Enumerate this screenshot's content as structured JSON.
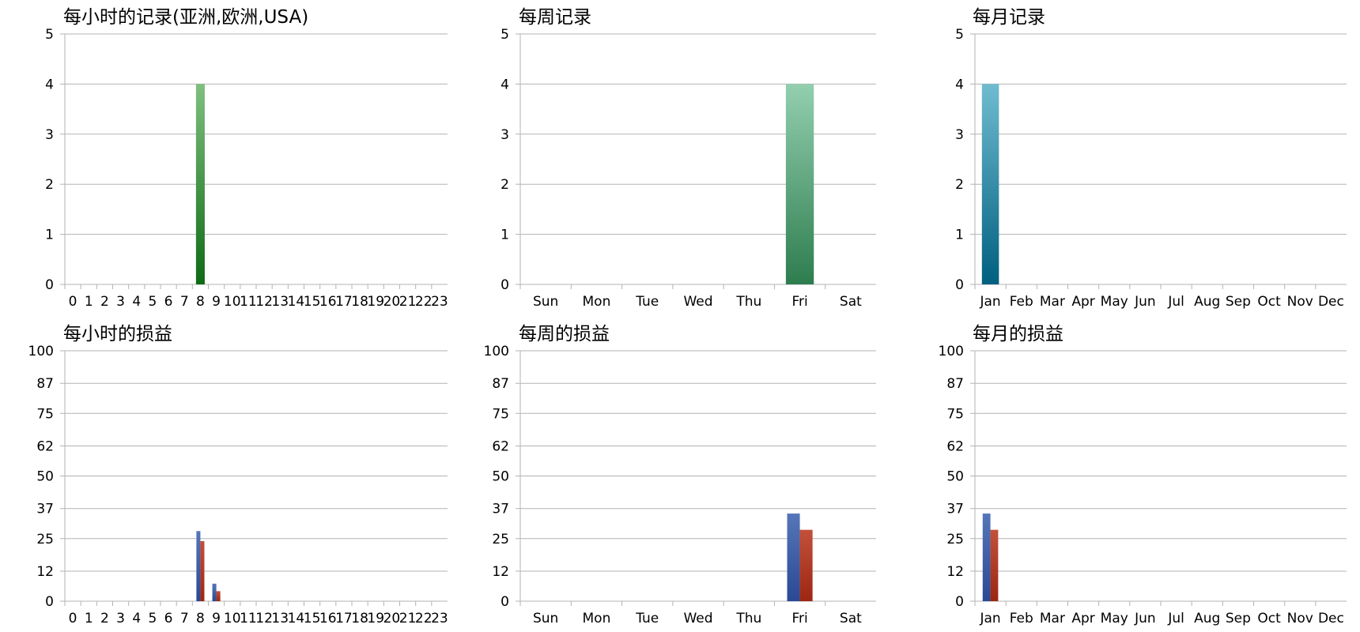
{
  "chart_data": [
    {
      "type": "bar",
      "title": "每小时的记录(亚洲,欧洲,USA)",
      "categories": [
        "0",
        "1",
        "2",
        "3",
        "4",
        "5",
        "6",
        "7",
        "8",
        "9",
        "10",
        "11",
        "12",
        "13",
        "14",
        "15",
        "16",
        "17",
        "18",
        "19",
        "20",
        "21",
        "22",
        "23"
      ],
      "ylim": [
        0,
        5
      ],
      "yticks": [
        "0",
        "1",
        "2",
        "3",
        "4",
        "5"
      ],
      "grid": true,
      "series": [
        {
          "values": [
            0,
            0,
            0,
            0,
            0,
            0,
            0,
            0,
            4,
            0,
            0,
            0,
            0,
            0,
            0,
            0,
            0,
            0,
            0,
            0,
            0,
            0,
            0,
            0
          ],
          "color_top": "#7fbf7f",
          "color_bottom": "#0e6b14"
        }
      ]
    },
    {
      "type": "bar",
      "title": "每周记录",
      "categories": [
        "Sun",
        "Mon",
        "Tue",
        "Wed",
        "Thu",
        "Fri",
        "Sat"
      ],
      "ylim": [
        0,
        5
      ],
      "yticks": [
        "0",
        "1",
        "2",
        "3",
        "4",
        "5"
      ],
      "grid": true,
      "series": [
        {
          "values": [
            0,
            0,
            0,
            0,
            0,
            4,
            0
          ],
          "color_top": "#93cfaf",
          "color_bottom": "#2e7d4f"
        }
      ]
    },
    {
      "type": "bar",
      "title": "每月记录",
      "categories": [
        "Jan",
        "Feb",
        "Mar",
        "Apr",
        "May",
        "Jun",
        "Jul",
        "Aug",
        "Sep",
        "Oct",
        "Nov",
        "Dec"
      ],
      "ylim": [
        0,
        5
      ],
      "yticks": [
        "0",
        "1",
        "2",
        "3",
        "4",
        "5"
      ],
      "grid": true,
      "series": [
        {
          "values": [
            4,
            0,
            0,
            0,
            0,
            0,
            0,
            0,
            0,
            0,
            0,
            0
          ],
          "color_top": "#6fbcd0",
          "color_bottom": "#005f7f"
        }
      ]
    },
    {
      "type": "bar",
      "title": "每小时的损益",
      "categories": [
        "0",
        "1",
        "2",
        "3",
        "4",
        "5",
        "6",
        "7",
        "8",
        "9",
        "10",
        "11",
        "12",
        "13",
        "14",
        "15",
        "16",
        "17",
        "18",
        "19",
        "20",
        "21",
        "22",
        "23"
      ],
      "ylim": [
        0,
        100
      ],
      "yticks": [
        "0",
        "12",
        "25",
        "37",
        "50",
        "62",
        "75",
        "87",
        "100"
      ],
      "grid": true,
      "series": [
        {
          "values": [
            0,
            0,
            0,
            0,
            0,
            0,
            0,
            0,
            28,
            7,
            0,
            0,
            0,
            0,
            0,
            0,
            0,
            0,
            0,
            0,
            0,
            0,
            0,
            0
          ],
          "color_top": "#5676b8",
          "color_bottom": "#2a4894"
        },
        {
          "values": [
            0,
            0,
            0,
            0,
            0,
            0,
            0,
            0,
            24,
            4,
            0,
            0,
            0,
            0,
            0,
            0,
            0,
            0,
            0,
            0,
            0,
            0,
            0,
            0
          ],
          "color_top": "#c2503a",
          "color_bottom": "#9c2712"
        }
      ]
    },
    {
      "type": "bar",
      "title": "每周的损益",
      "categories": [
        "Sun",
        "Mon",
        "Tue",
        "Wed",
        "Thu",
        "Fri",
        "Sat"
      ],
      "ylim": [
        0,
        100
      ],
      "yticks": [
        "0",
        "12",
        "25",
        "37",
        "50",
        "62",
        "75",
        "87",
        "100"
      ],
      "grid": true,
      "series": [
        {
          "values": [
            0,
            0,
            0,
            0,
            0,
            35,
            0
          ],
          "color_top": "#5676b8",
          "color_bottom": "#2a4894"
        },
        {
          "values": [
            0,
            0,
            0,
            0,
            0,
            28.5,
            0
          ],
          "color_top": "#c2503a",
          "color_bottom": "#9c2712"
        }
      ]
    },
    {
      "type": "bar",
      "title": "每月的损益",
      "categories": [
        "Jan",
        "Feb",
        "Mar",
        "Apr",
        "May",
        "Jun",
        "Jul",
        "Aug",
        "Sep",
        "Oct",
        "Nov",
        "Dec"
      ],
      "ylim": [
        0,
        100
      ],
      "yticks": [
        "0",
        "12",
        "25",
        "37",
        "50",
        "62",
        "75",
        "87",
        "100"
      ],
      "grid": true,
      "series": [
        {
          "values": [
            35,
            0,
            0,
            0,
            0,
            0,
            0,
            0,
            0,
            0,
            0,
            0
          ],
          "color_top": "#5676b8",
          "color_bottom": "#2a4894"
        },
        {
          "values": [
            28.5,
            0,
            0,
            0,
            0,
            0,
            0,
            0,
            0,
            0,
            0,
            0
          ],
          "color_top": "#c2503a",
          "color_bottom": "#9c2712"
        }
      ]
    }
  ]
}
